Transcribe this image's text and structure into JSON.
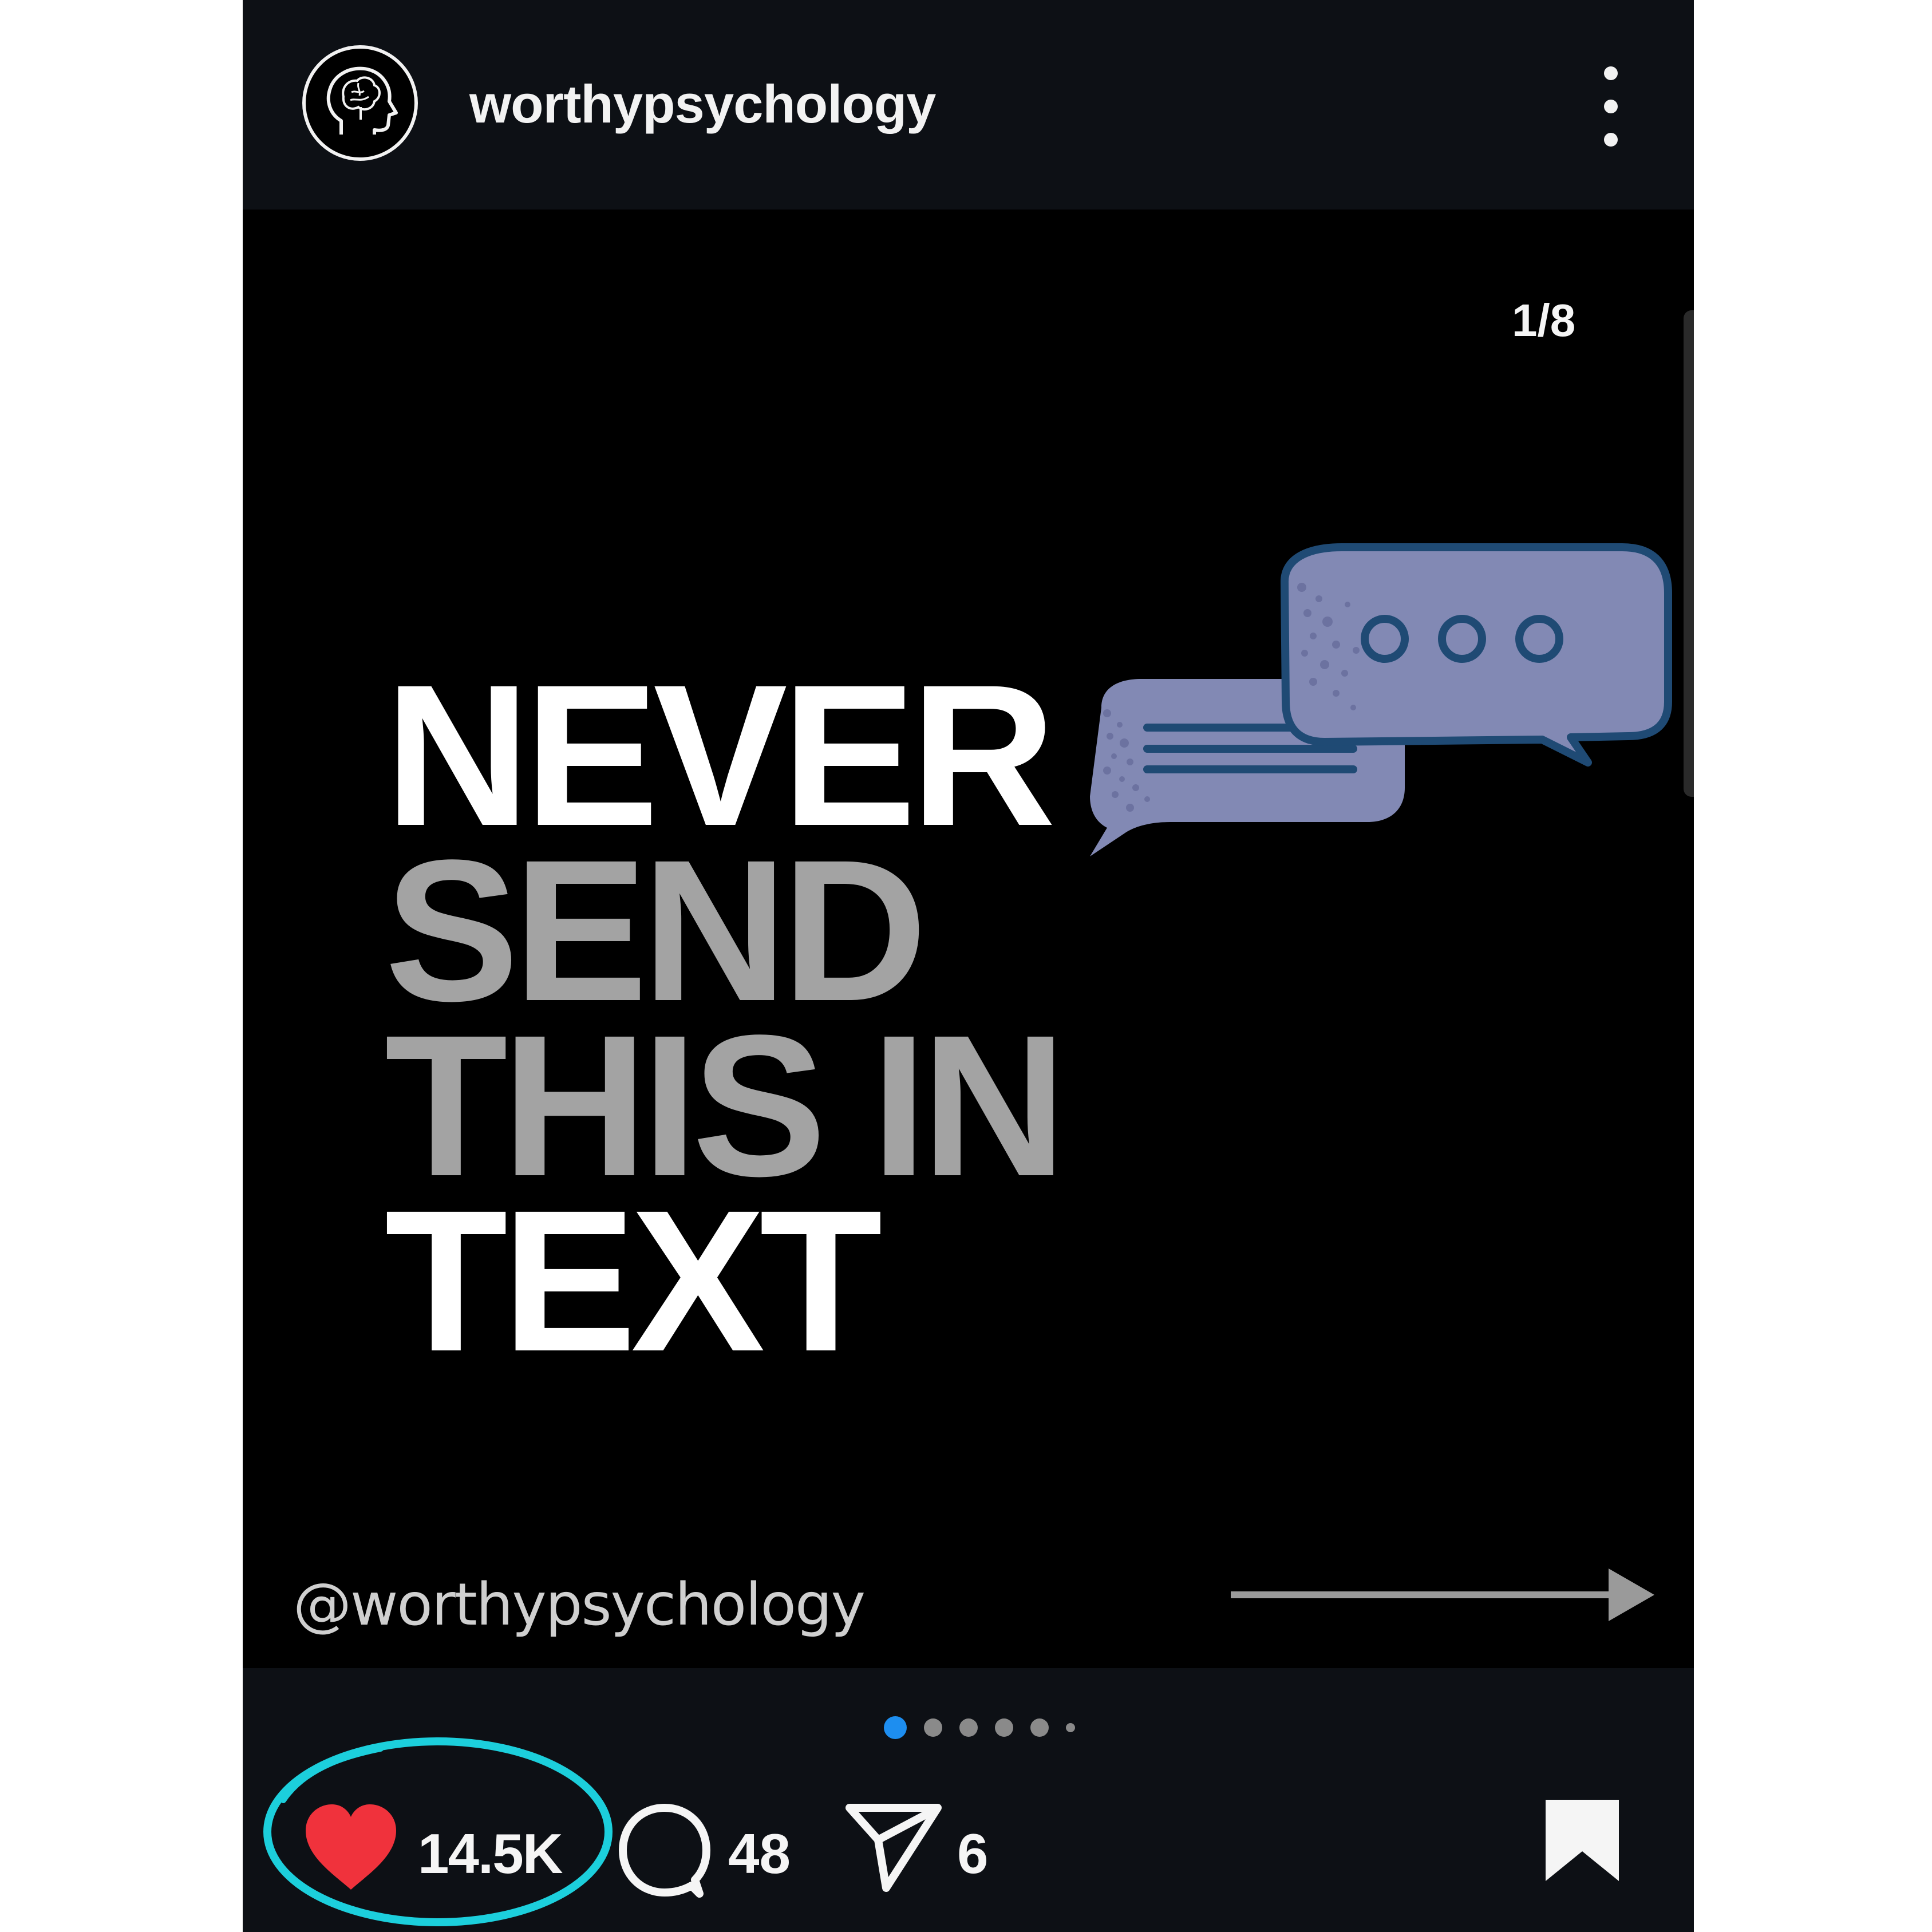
{
  "header": {
    "username": "worthypsychology",
    "avatar_icon": "head-brain-icon",
    "more_icon": "more-vertical-icon"
  },
  "media": {
    "counter": "1/8",
    "headline": {
      "line1": "NEVER",
      "line2": "SEND",
      "line3": "THIS IN",
      "line4": "TEXT"
    },
    "handle": "@worthypsychology",
    "illustration": "chat-bubbles-icon",
    "next_arrow_icon": "arrow-right-icon"
  },
  "carousel": {
    "total_dots": 6,
    "active_index": 0
  },
  "actions": {
    "like_count": "14.5K",
    "comment_count": "48",
    "share_count": "6",
    "liked": true
  },
  "colors": {
    "background": "#0d1015",
    "heart": "#f0323c",
    "active_dot": "#1d8ef0",
    "highlight_circle": "#1ccfdc",
    "bubble_fill": "#8289b4",
    "bubble_outline": "#1f4a74"
  }
}
